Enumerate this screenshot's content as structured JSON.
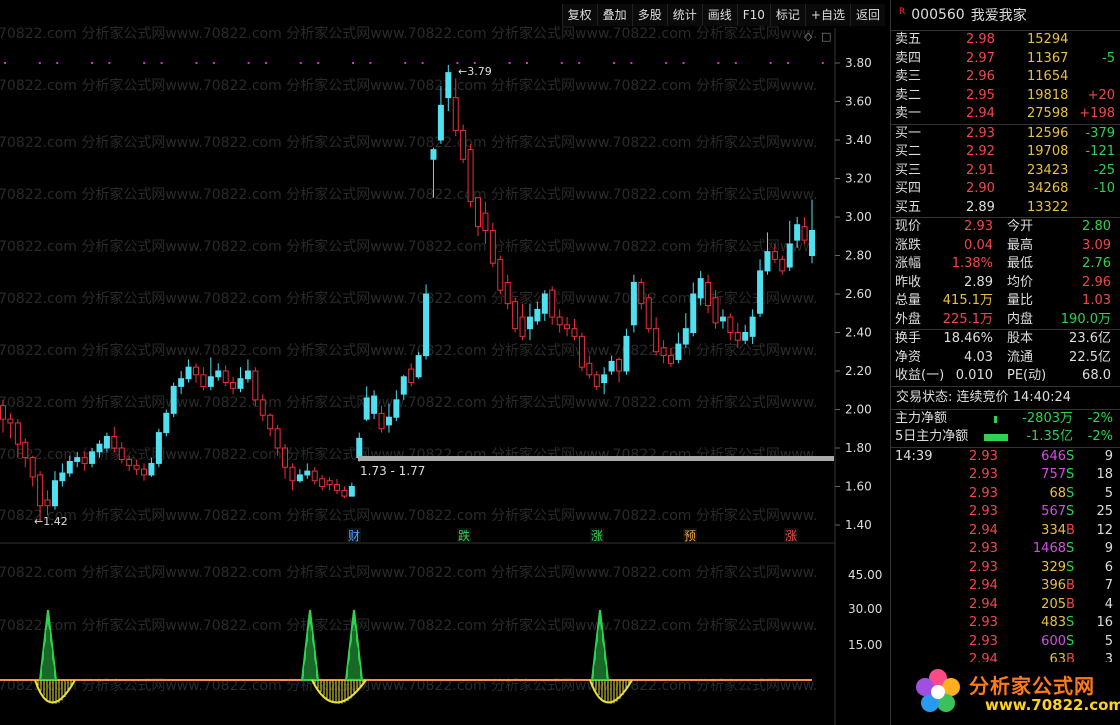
{
  "toolbar": {
    "buttons": [
      "复权",
      "叠加",
      "多股",
      "统计",
      "画线",
      "F10",
      "标记",
      "+自选",
      "返回"
    ]
  },
  "watermark": "70822.com 分析家公式网www.70822.com 分析家公式网www.70822.com 分析家公式网www.70822.com 分析家公式网www.",
  "stock": {
    "r_tag": "R",
    "code": "000560",
    "name": "我爱我家"
  },
  "order_book": {
    "asks": [
      {
        "label": "卖五",
        "price": "2.98",
        "vol": "15294",
        "chg": ""
      },
      {
        "label": "卖四",
        "price": "2.97",
        "vol": "11367",
        "chg": "-5"
      },
      {
        "label": "卖三",
        "price": "2.96",
        "vol": "11654",
        "chg": ""
      },
      {
        "label": "卖二",
        "price": "2.95",
        "vol": "19818",
        "chg": "+20"
      },
      {
        "label": "卖一",
        "price": "2.94",
        "vol": "27598",
        "chg": "+198"
      }
    ],
    "bids": [
      {
        "label": "买一",
        "price": "2.93",
        "vol": "12596",
        "chg": "-379"
      },
      {
        "label": "买二",
        "price": "2.92",
        "vol": "19708",
        "chg": "-121"
      },
      {
        "label": "买三",
        "price": "2.91",
        "vol": "23423",
        "chg": "-25"
      },
      {
        "label": "买四",
        "price": "2.90",
        "vol": "34268",
        "chg": "-10"
      },
      {
        "label": "买五",
        "price": "2.89",
        "vol": "13322",
        "chg": ""
      }
    ]
  },
  "stats": [
    {
      "l1": "现价",
      "v1": "2.93",
      "l2": "今开",
      "v2": "2.80"
    },
    {
      "l1": "涨跌",
      "v1": "0.04",
      "l2": "最高",
      "v2": "3.09"
    },
    {
      "l1": "涨幅",
      "v1": "1.38%",
      "l2": "最低",
      "v2": "2.76"
    },
    {
      "l1": "昨收",
      "v1": "2.89",
      "l2": "均价",
      "v2": "2.96"
    },
    {
      "l1": "总量",
      "v1": "415.1万",
      "l2": "量比",
      "v2": "1.03"
    },
    {
      "l1": "外盘",
      "v1": "225.1万",
      "l2": "内盘",
      "v2": "190.0万"
    }
  ],
  "stats2": [
    {
      "l1": "换手",
      "v1": "18.46%",
      "l2": "股本",
      "v2": "23.6亿"
    },
    {
      "l1": "净资",
      "v1": "4.03",
      "l2": "流通",
      "v2": "22.5亿"
    },
    {
      "l1": "收益(一)",
      "v1": "0.010",
      "l2": "PE(动)",
      "v2": "68.0"
    }
  ],
  "status": {
    "label": "交易状态:",
    "value": "连续竞价",
    "time": "14:40:24"
  },
  "flow": [
    {
      "label": "主力净额",
      "value": "-2803万",
      "pct": "-2%"
    },
    {
      "label": "5日主力净额",
      "value": "-1.35亿",
      "pct": "-2%"
    }
  ],
  "ticks": [
    {
      "t": "14:39",
      "p": "2.93",
      "v": "646",
      "d": "S",
      "n": "9"
    },
    {
      "t": "",
      "p": "2.93",
      "v": "757",
      "d": "S",
      "n": "18"
    },
    {
      "t": "",
      "p": "2.93",
      "v": "68",
      "d": "S",
      "n": "5"
    },
    {
      "t": "",
      "p": "2.93",
      "v": "567",
      "d": "S",
      "n": "25"
    },
    {
      "t": "",
      "p": "2.94",
      "v": "334",
      "d": "B",
      "n": "12"
    },
    {
      "t": "",
      "p": "2.93",
      "v": "1468",
      "d": "S",
      "n": "9"
    },
    {
      "t": "",
      "p": "2.93",
      "v": "329",
      "d": "S",
      "n": "6"
    },
    {
      "t": "",
      "p": "2.94",
      "v": "396",
      "d": "B",
      "n": "7"
    },
    {
      "t": "",
      "p": "2.94",
      "v": "205",
      "d": "B",
      "n": "4"
    },
    {
      "t": "",
      "p": "2.93",
      "v": "483",
      "d": "S",
      "n": "16"
    },
    {
      "t": "",
      "p": "2.93",
      "v": "600",
      "d": "S",
      "n": "5"
    },
    {
      "t": "",
      "p": "2.94",
      "v": "63",
      "d": "B",
      "n": "3"
    }
  ],
  "logo": {
    "cn": "分析家公式网",
    "url": "www.70822.com"
  },
  "chart_data": {
    "type": "candlestick",
    "price_axis": {
      "min": 1.4,
      "max": 3.8,
      "ticks": [
        "3.80",
        "3.60",
        "3.40",
        "3.20",
        "3.00",
        "2.80",
        "2.60",
        "2.40",
        "2.20",
        "2.00",
        "1.80",
        "1.60",
        "1.40"
      ]
    },
    "indicator_axis": {
      "ticks": [
        "45.00",
        "30.00",
        "15.00"
      ]
    },
    "annotations": {
      "high": "3.79",
      "low": "1.42",
      "range": "1.73 - 1.77"
    },
    "markers": [
      {
        "text": "财",
        "color": "#4aa0ff"
      },
      {
        "text": "跌",
        "color": "#2fd24f"
      },
      {
        "text": "涨",
        "color": "#2fd24f"
      },
      {
        "text": "预",
        "color": "#e8a040"
      },
      {
        "text": "涨",
        "color": "#f04848"
      }
    ],
    "candles": [
      [
        1.95,
        2.02,
        1.88,
        2.05
      ],
      [
        1.93,
        1.95,
        1.85,
        1.98
      ],
      [
        1.82,
        1.93,
        1.75,
        1.95
      ],
      [
        1.75,
        1.83,
        1.7,
        1.85
      ],
      [
        1.65,
        1.75,
        1.6,
        1.76
      ],
      [
        1.5,
        1.66,
        1.42,
        1.68
      ],
      [
        1.5,
        1.53,
        1.45,
        1.58
      ],
      [
        1.63,
        1.5,
        1.48,
        1.68
      ],
      [
        1.67,
        1.63,
        1.6,
        1.72
      ],
      [
        1.73,
        1.67,
        1.65,
        1.76
      ],
      [
        1.75,
        1.73,
        1.7,
        1.78
      ],
      [
        1.72,
        1.75,
        1.68,
        1.78
      ],
      [
        1.78,
        1.72,
        1.7,
        1.8
      ],
      [
        1.82,
        1.78,
        1.75,
        1.84
      ],
      [
        1.86,
        1.8,
        1.78,
        1.88
      ],
      [
        1.8,
        1.86,
        1.78,
        1.91
      ],
      [
        1.74,
        1.8,
        1.72,
        1.83
      ],
      [
        1.71,
        1.74,
        1.68,
        1.76
      ],
      [
        1.69,
        1.71,
        1.66,
        1.74
      ],
      [
        1.66,
        1.69,
        1.63,
        1.72
      ],
      [
        1.72,
        1.66,
        1.65,
        1.75
      ],
      [
        1.88,
        1.72,
        1.7,
        1.9
      ],
      [
        1.98,
        1.88,
        1.86,
        2.0
      ],
      [
        2.12,
        1.98,
        1.96,
        2.14
      ],
      [
        2.16,
        2.12,
        2.08,
        2.2
      ],
      [
        2.22,
        2.16,
        2.14,
        2.26
      ],
      [
        2.18,
        2.22,
        2.14,
        2.24
      ],
      [
        2.12,
        2.18,
        2.1,
        2.22
      ],
      [
        2.17,
        2.12,
        2.1,
        2.27
      ],
      [
        2.2,
        2.17,
        2.15,
        2.24
      ],
      [
        2.14,
        2.2,
        2.12,
        2.23
      ],
      [
        2.11,
        2.14,
        2.08,
        2.17
      ],
      [
        2.16,
        2.11,
        2.09,
        2.22
      ],
      [
        2.2,
        2.16,
        2.14,
        2.26
      ],
      [
        2.05,
        2.2,
        2.02,
        2.22
      ],
      [
        1.97,
        2.05,
        1.94,
        2.08
      ],
      [
        1.9,
        1.97,
        1.86,
        1.98
      ],
      [
        1.8,
        1.9,
        1.76,
        1.92
      ],
      [
        1.7,
        1.8,
        1.64,
        1.82
      ],
      [
        1.63,
        1.7,
        1.58,
        1.72
      ],
      [
        1.66,
        1.63,
        1.62,
        1.69
      ],
      [
        1.68,
        1.66,
        1.64,
        1.72
      ],
      [
        1.63,
        1.68,
        1.61,
        1.7
      ],
      [
        1.6,
        1.64,
        1.58,
        1.66
      ],
      [
        1.61,
        1.63,
        1.58,
        1.65
      ],
      [
        1.58,
        1.61,
        1.56,
        1.64
      ],
      [
        1.55,
        1.58,
        1.54,
        1.6
      ],
      [
        1.6,
        1.55,
        1.55,
        1.62
      ],
      [
        1.85,
        1.75,
        1.73,
        1.88
      ],
      [
        2.06,
        1.95,
        1.94,
        2.12
      ],
      [
        2.07,
        1.98,
        1.95,
        2.1
      ],
      [
        1.9,
        1.98,
        1.88,
        2.02
      ],
      [
        1.96,
        1.92,
        1.88,
        2.03
      ],
      [
        2.05,
        1.96,
        1.94,
        2.1
      ],
      [
        2.17,
        2.08,
        2.05,
        2.18
      ],
      [
        2.14,
        2.21,
        2.12,
        2.24
      ],
      [
        2.28,
        2.17,
        2.16,
        2.3
      ],
      [
        2.6,
        2.28,
        2.26,
        2.65
      ],
      [
        3.35,
        3.3,
        3.1,
        3.36
      ],
      [
        3.58,
        3.4,
        3.38,
        3.68
      ],
      [
        3.75,
        3.62,
        3.55,
        3.79
      ],
      [
        3.45,
        3.62,
        3.42,
        3.72
      ],
      [
        3.3,
        3.45,
        3.28,
        3.48
      ],
      [
        3.08,
        3.35,
        3.05,
        3.38
      ],
      [
        2.95,
        3.1,
        2.9,
        3.1
      ],
      [
        2.93,
        3.02,
        2.86,
        3.08
      ],
      [
        2.76,
        2.93,
        2.74,
        2.97
      ],
      [
        2.62,
        2.78,
        2.6,
        2.8
      ],
      [
        2.55,
        2.66,
        2.52,
        2.7
      ],
      [
        2.42,
        2.56,
        2.4,
        2.58
      ],
      [
        2.38,
        2.48,
        2.36,
        2.55
      ],
      [
        2.48,
        2.42,
        2.36,
        2.55
      ],
      [
        2.52,
        2.46,
        2.44,
        2.56
      ],
      [
        2.6,
        2.5,
        2.46,
        2.62
      ],
      [
        2.48,
        2.62,
        2.44,
        2.64
      ],
      [
        2.44,
        2.48,
        2.4,
        2.52
      ],
      [
        2.42,
        2.44,
        2.38,
        2.48
      ],
      [
        2.38,
        2.42,
        2.36,
        2.47
      ],
      [
        2.22,
        2.38,
        2.2,
        2.4
      ],
      [
        2.18,
        2.24,
        2.16,
        2.28
      ],
      [
        2.12,
        2.18,
        2.1,
        2.2
      ],
      [
        2.18,
        2.14,
        2.08,
        2.22
      ],
      [
        2.25,
        2.2,
        2.18,
        2.28
      ],
      [
        2.2,
        2.26,
        2.14,
        2.27
      ],
      [
        2.38,
        2.2,
        2.18,
        2.42
      ],
      [
        2.66,
        2.44,
        2.4,
        2.7
      ],
      [
        2.55,
        2.66,
        2.52,
        2.68
      ],
      [
        2.42,
        2.58,
        2.4,
        2.6
      ],
      [
        2.3,
        2.42,
        2.28,
        2.48
      ],
      [
        2.28,
        2.32,
        2.24,
        2.36
      ],
      [
        2.24,
        2.28,
        2.22,
        2.32
      ],
      [
        2.34,
        2.26,
        2.24,
        2.4
      ],
      [
        2.42,
        2.34,
        2.32,
        2.5
      ],
      [
        2.6,
        2.4,
        2.38,
        2.66
      ],
      [
        2.68,
        2.58,
        2.54,
        2.72
      ],
      [
        2.54,
        2.66,
        2.5,
        2.7
      ],
      [
        2.45,
        2.58,
        2.42,
        2.62
      ],
      [
        2.48,
        2.46,
        2.42,
        2.52
      ],
      [
        2.4,
        2.48,
        2.36,
        2.5
      ],
      [
        2.36,
        2.4,
        2.32,
        2.45
      ],
      [
        2.4,
        2.36,
        2.34,
        2.44
      ],
      [
        2.48,
        2.38,
        2.34,
        2.52
      ],
      [
        2.72,
        2.5,
        2.48,
        2.78
      ],
      [
        2.82,
        2.72,
        2.7,
        2.92
      ],
      [
        2.78,
        2.82,
        2.76,
        2.86
      ],
      [
        2.72,
        2.78,
        2.7,
        2.8
      ],
      [
        2.86,
        2.74,
        2.72,
        2.98
      ],
      [
        2.96,
        2.88,
        2.84,
        3.0
      ],
      [
        2.88,
        2.95,
        2.86,
        3.0
      ],
      [
        2.93,
        2.8,
        2.76,
        3.09
      ]
    ],
    "indicator": {
      "green_peaks": [
        6,
        42,
        48,
        81
      ],
      "yellow_dips": [
        [
          2,
          10
        ],
        [
          39,
          48
        ],
        [
          80,
          90
        ]
      ]
    }
  }
}
